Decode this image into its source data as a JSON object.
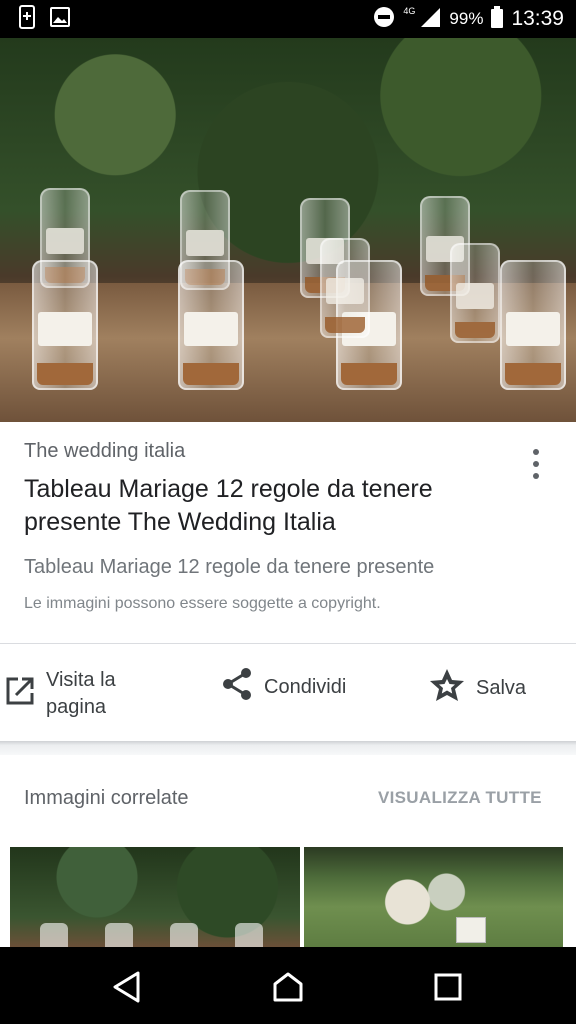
{
  "status_bar": {
    "network_label": "4G",
    "battery": "99%",
    "time": "13:39"
  },
  "result": {
    "source": "The wedding italia",
    "title": "Tableau Mariage 12 regole da tenere presente The Wedding Italia",
    "description": "Tableau Mariage 12 regole da tenere presente",
    "copyright_notice": "Le immagini possono essere soggette a copyright."
  },
  "actions": {
    "visit_label": "Visita la pagina",
    "share_label": "Condividi",
    "save_label": "Salva"
  },
  "related": {
    "title": "Immagini correlate",
    "view_all_label": "VISUALIZZA TUTTE"
  },
  "colors": {
    "status_bar_bg": "#000000",
    "text_primary": "#202124",
    "text_secondary": "#5f6368",
    "view_all": "#9aa0a6"
  },
  "icons": [
    "screenshot-icon",
    "image-icon",
    "do-not-disturb-icon",
    "signal-icon",
    "battery-icon",
    "more-vert-icon",
    "open-in-new-icon",
    "share-icon",
    "star-icon",
    "back-icon",
    "home-icon",
    "recents-icon"
  ]
}
